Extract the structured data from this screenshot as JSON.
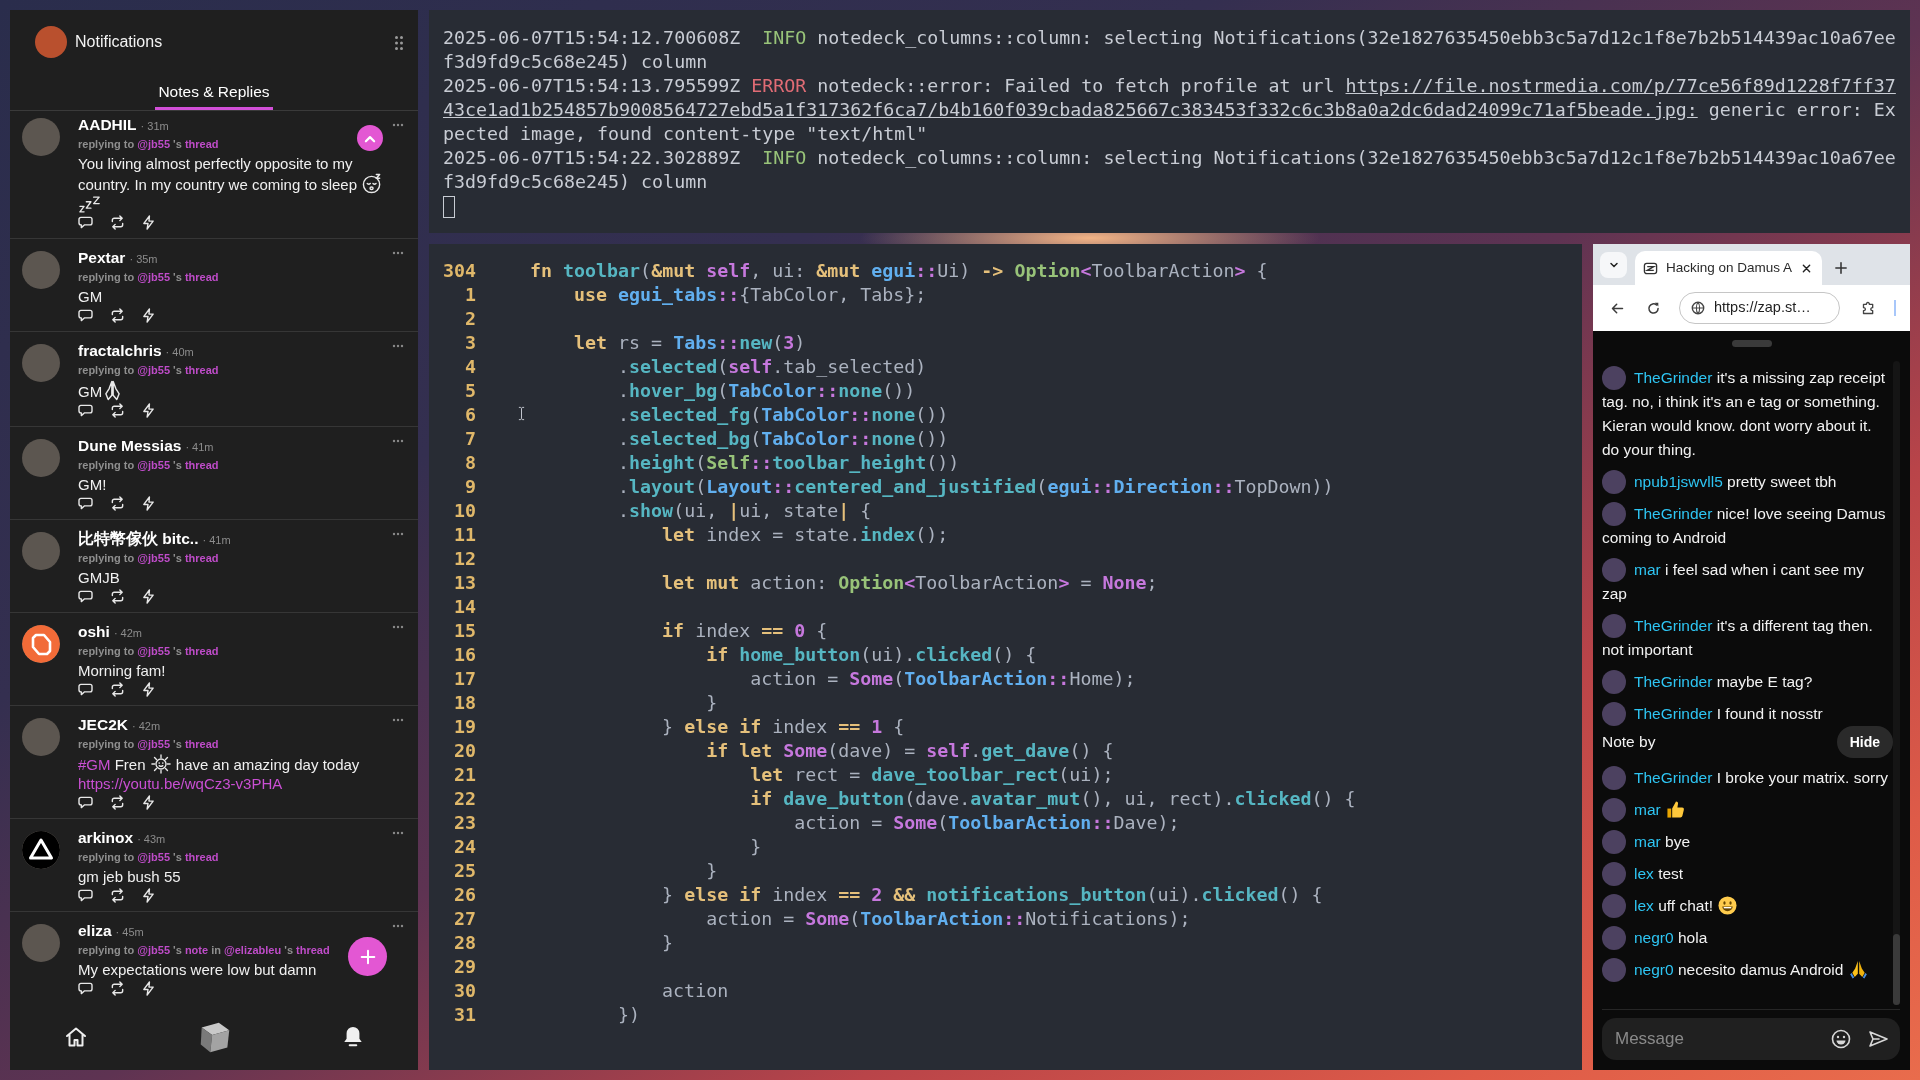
{
  "notifications_panel": {
    "title": "Notifications",
    "tabs": [
      {
        "label": "Notes & Replies",
        "selected": true
      }
    ],
    "notes": [
      {
        "author": "AADHIL",
        "time": "· 31m",
        "avatar": {
          "kind": "photo"
        },
        "reply": [
          {
            "kind": "text",
            "text": "replying to "
          },
          {
            "kind": "link",
            "text": "@jb55"
          },
          {
            "kind": "text",
            "text": " 's "
          },
          {
            "kind": "link",
            "text": "thread"
          }
        ],
        "content": [
          {
            "kind": "text",
            "text": "You living almost perfectly opposite to my country. In my country we coming to sleep "
          },
          {
            "kind": "sleepface"
          },
          {
            "kind": "zzz"
          }
        ]
      },
      {
        "author": "Pextar",
        "time": "· 35m",
        "avatar": {
          "kind": "photo"
        },
        "reply": [
          {
            "kind": "text",
            "text": "replying to "
          },
          {
            "kind": "link",
            "text": "@jb55"
          },
          {
            "kind": "text",
            "text": " 's "
          },
          {
            "kind": "link",
            "text": "thread"
          }
        ],
        "content": [
          {
            "kind": "text",
            "text": "GM"
          }
        ]
      },
      {
        "author": "fractalchris",
        "time": "· 40m",
        "avatar": {
          "kind": "photo"
        },
        "reply": [
          {
            "kind": "text",
            "text": "replying to "
          },
          {
            "kind": "link",
            "text": "@jb55"
          },
          {
            "kind": "text",
            "text": " 's "
          },
          {
            "kind": "link",
            "text": "thread"
          }
        ],
        "content": [
          {
            "kind": "text",
            "text": "GM"
          },
          {
            "kind": "palms"
          }
        ]
      },
      {
        "author": "Dune Messias",
        "time": "· 41m",
        "avatar": {
          "kind": "photo"
        },
        "reply": [
          {
            "kind": "text",
            "text": "replying to "
          },
          {
            "kind": "link",
            "text": "@jb55"
          },
          {
            "kind": "text",
            "text": " 's "
          },
          {
            "kind": "link",
            "text": "thread"
          }
        ],
        "content": [
          {
            "kind": "text",
            "text": "GM!"
          }
        ]
      },
      {
        "author": "比特幣傢伙 bitc..",
        "time": "· 41m",
        "avatar": {
          "kind": "photo"
        },
        "reply": [
          {
            "kind": "text",
            "text": "replying to "
          },
          {
            "kind": "link",
            "text": "@jb55"
          },
          {
            "kind": "text",
            "text": " 's "
          },
          {
            "kind": "link",
            "text": "thread"
          }
        ],
        "content": [
          {
            "kind": "text",
            "text": "GMJB"
          }
        ]
      },
      {
        "author": "oshi",
        "time": "· 42m",
        "avatar": {
          "kind": "octagon"
        },
        "reply": [
          {
            "kind": "text",
            "text": "replying to "
          },
          {
            "kind": "link",
            "text": "@jb55"
          },
          {
            "kind": "text",
            "text": " 's "
          },
          {
            "kind": "link",
            "text": "thread"
          }
        ],
        "content": [
          {
            "kind": "text",
            "text": "Morning fam!"
          }
        ]
      },
      {
        "author": "JEC2K",
        "time": "· 42m",
        "avatar": {
          "kind": "photo"
        },
        "reply": [
          {
            "kind": "text",
            "text": "replying to "
          },
          {
            "kind": "link",
            "text": "@jb55"
          },
          {
            "kind": "text",
            "text": " 's "
          },
          {
            "kind": "link",
            "text": "thread"
          }
        ],
        "content": [
          {
            "kind": "hashtag",
            "text": "#GM"
          },
          {
            "kind": "text",
            "text": " Fren "
          },
          {
            "kind": "sunface"
          },
          {
            "kind": "text",
            "text": " have an amazing day today "
          },
          {
            "kind": "url",
            "text": "https://youtu.be/wqCz3-v3PHA"
          }
        ]
      },
      {
        "author": "arkinox",
        "time": "· 43m",
        "avatar": {
          "kind": "triangle"
        },
        "reply": [
          {
            "kind": "text",
            "text": "replying to "
          },
          {
            "kind": "link",
            "text": "@jb55"
          },
          {
            "kind": "text",
            "text": " 's "
          },
          {
            "kind": "link",
            "text": "thread"
          }
        ],
        "content": [
          {
            "kind": "text",
            "text": "gm jeb bush 55"
          }
        ]
      },
      {
        "author": "eliza",
        "time": "· 45m",
        "avatar": {
          "kind": "photo"
        },
        "reply": [
          {
            "kind": "text",
            "text": "replying to "
          },
          {
            "kind": "link",
            "text": "@jb55"
          },
          {
            "kind": "text",
            "text": " 's "
          },
          {
            "kind": "link",
            "text": "note"
          },
          {
            "kind": "text",
            "text": " in "
          },
          {
            "kind": "link",
            "text": "@elizableu"
          },
          {
            "kind": "text",
            "text": " 's "
          },
          {
            "kind": "link",
            "text": "thread"
          }
        ],
        "content": [
          {
            "kind": "text",
            "text": "My expectations were low but damn"
          }
        ]
      }
    ]
  },
  "terminal": {
    "lines": [
      {
        "time": "2025-06-07T15:54:12.700608Z",
        "severity": "INFO",
        "kind": "info",
        "message": [
          {
            "kind": "text",
            "text": "notedeck_columns::column: selecting Notifications(32e1827635450ebb3c5a7d12c1f8e7b2b514439ac10a67eef3d9fd9c5c68e245) column"
          }
        ]
      },
      {
        "time": "2025-06-07T15:54:13.795599Z",
        "severity": "ERROR",
        "kind": "error",
        "message": [
          {
            "kind": "text",
            "text": "notedeck::error: Failed to fetch profile at url "
          },
          {
            "kind": "link",
            "text": "https://file.nostrmedia.com/p/77ce56f89d1228f7ff3743ce1ad1b254857b9008564727ebd5a1f317362f6ca7/b4b160f039cbada825667c383453f332c6c3b8a0a2dc6dad24099c71af5beade.jpg:"
          },
          {
            "kind": "text",
            "text": " generic error: Expected image, found content-type \"text/html\""
          }
        ]
      },
      {
        "time": "2025-06-07T15:54:22.302889Z",
        "severity": "INFO",
        "kind": "info",
        "message": [
          {
            "kind": "text",
            "text": "notedeck_columns::column: selecting Notifications(32e1827635450ebb3c5a7d12c1f8e7b2b514439ac10a67eef3d9fd9c5c68e245) column"
          }
        ]
      }
    ]
  },
  "editor": {
    "lines": [
      {
        "number": "304",
        "tokens": [
          {
            "kind": "kw",
            "text": "    fn "
          },
          {
            "kind": "fn",
            "text": "toolbar"
          },
          {
            "kind": "tx",
            "text": "("
          },
          {
            "kind": "kw",
            "text": "&mut "
          },
          {
            "kind": "lit",
            "text": "self"
          },
          {
            "kind": "tx",
            "text": ", ui: "
          },
          {
            "kind": "kw",
            "text": "&mut "
          },
          {
            "kind": "ty",
            "text": "egui"
          },
          {
            "kind": "lit",
            "text": "::"
          },
          {
            "kind": "tx",
            "text": "Ui) "
          },
          {
            "kind": "kw",
            "text": "-> "
          },
          {
            "kind": "std",
            "text": "Option"
          },
          {
            "kind": "lit",
            "text": "<"
          },
          {
            "kind": "tx",
            "text": "ToolbarAction"
          },
          {
            "kind": "lit",
            "text": ">"
          },
          {
            "kind": "tx",
            "text": " {"
          }
        ]
      },
      {
        "number": "1",
        "tokens": [
          {
            "kind": "kw",
            "text": "        use "
          },
          {
            "kind": "ty",
            "text": "egui_tabs"
          },
          {
            "kind": "lit",
            "text": "::"
          },
          {
            "kind": "tx",
            "text": "{TabColor, Tabs};"
          }
        ]
      },
      {
        "number": "2"
      },
      {
        "number": "3",
        "tokens": [
          {
            "kind": "kw",
            "text": "        let"
          },
          {
            "kind": "tx",
            "text": " rs = "
          },
          {
            "kind": "ty",
            "text": "Tabs"
          },
          {
            "kind": "lit",
            "text": "::"
          },
          {
            "kind": "fn",
            "text": "new"
          },
          {
            "kind": "tx",
            "text": "("
          },
          {
            "kind": "lit",
            "text": "3"
          },
          {
            "kind": "tx",
            "text": ")"
          }
        ]
      },
      {
        "number": "4",
        "tokens": [
          {
            "kind": "tx",
            "text": "            ."
          },
          {
            "kind": "fn",
            "text": "selected"
          },
          {
            "kind": "tx",
            "text": "("
          },
          {
            "kind": "lit",
            "text": "self"
          },
          {
            "kind": "tx",
            "text": ".tab_selected)"
          }
        ]
      },
      {
        "number": "5",
        "tokens": [
          {
            "kind": "tx",
            "text": "            ."
          },
          {
            "kind": "fn",
            "text": "hover_bg"
          },
          {
            "kind": "tx",
            "text": "("
          },
          {
            "kind": "ty",
            "text": "TabColor"
          },
          {
            "kind": "lit",
            "text": "::"
          },
          {
            "kind": "fn",
            "text": "none"
          },
          {
            "kind": "tx",
            "text": "())"
          }
        ]
      },
      {
        "number": "6",
        "tokens": [
          {
            "kind": "tx",
            "text": "            ."
          },
          {
            "kind": "fn",
            "text": "selected_fg"
          },
          {
            "kind": "tx",
            "text": "("
          },
          {
            "kind": "ty",
            "text": "TabColor"
          },
          {
            "kind": "lit",
            "text": "::"
          },
          {
            "kind": "fn",
            "text": "none"
          },
          {
            "kind": "tx",
            "text": "())"
          }
        ]
      },
      {
        "number": "7",
        "tokens": [
          {
            "kind": "tx",
            "text": "            ."
          },
          {
            "kind": "fn",
            "text": "selected_bg"
          },
          {
            "kind": "tx",
            "text": "("
          },
          {
            "kind": "ty",
            "text": "TabColor"
          },
          {
            "kind": "lit",
            "text": "::"
          },
          {
            "kind": "fn",
            "text": "none"
          },
          {
            "kind": "tx",
            "text": "())"
          }
        ]
      },
      {
        "number": "8",
        "tokens": [
          {
            "kind": "tx",
            "text": "            ."
          },
          {
            "kind": "fn",
            "text": "height"
          },
          {
            "kind": "tx",
            "text": "("
          },
          {
            "kind": "std",
            "text": "Self"
          },
          {
            "kind": "lit",
            "text": "::"
          },
          {
            "kind": "fn",
            "text": "toolbar_height"
          },
          {
            "kind": "tx",
            "text": "())"
          }
        ]
      },
      {
        "number": "9",
        "tokens": [
          {
            "kind": "tx",
            "text": "            ."
          },
          {
            "kind": "fn",
            "text": "layout"
          },
          {
            "kind": "tx",
            "text": "("
          },
          {
            "kind": "ty",
            "text": "Layout"
          },
          {
            "kind": "lit",
            "text": "::"
          },
          {
            "kind": "fn",
            "text": "centered_and_justified"
          },
          {
            "kind": "tx",
            "text": "("
          },
          {
            "kind": "ty",
            "text": "egui"
          },
          {
            "kind": "lit",
            "text": "::"
          },
          {
            "kind": "ty",
            "text": "Direction"
          },
          {
            "kind": "lit",
            "text": "::"
          },
          {
            "kind": "tx",
            "text": "TopDown))"
          }
        ]
      },
      {
        "number": "10",
        "tokens": [
          {
            "kind": "tx",
            "text": "            ."
          },
          {
            "kind": "fn",
            "text": "show"
          },
          {
            "kind": "tx",
            "text": "(ui, "
          },
          {
            "kind": "kw",
            "text": "|"
          },
          {
            "kind": "tx",
            "text": "ui, state"
          },
          {
            "kind": "kw",
            "text": "|"
          },
          {
            "kind": "tx",
            "text": " {"
          }
        ]
      },
      {
        "number": "11",
        "tokens": [
          {
            "kind": "kw",
            "text": "                let"
          },
          {
            "kind": "tx",
            "text": " index = state."
          },
          {
            "kind": "fn",
            "text": "index"
          },
          {
            "kind": "tx",
            "text": "();"
          }
        ]
      },
      {
        "number": "12"
      },
      {
        "number": "13",
        "tokens": [
          {
            "kind": "kw",
            "text": "                let mut"
          },
          {
            "kind": "tx",
            "text": " action: "
          },
          {
            "kind": "std",
            "text": "Option"
          },
          {
            "kind": "lit",
            "text": "<"
          },
          {
            "kind": "tx",
            "text": "ToolbarAction"
          },
          {
            "kind": "lit",
            "text": ">"
          },
          {
            "kind": "tx",
            "text": " = "
          },
          {
            "kind": "lit",
            "text": "None"
          },
          {
            "kind": "tx",
            "text": ";"
          }
        ]
      },
      {
        "number": "14"
      },
      {
        "number": "15",
        "tokens": [
          {
            "kind": "kw",
            "text": "                if"
          },
          {
            "kind": "tx",
            "text": " index "
          },
          {
            "kind": "kw",
            "text": "== "
          },
          {
            "kind": "lit",
            "text": "0"
          },
          {
            "kind": "tx",
            "text": " {"
          }
        ]
      },
      {
        "number": "16",
        "tokens": [
          {
            "kind": "kw",
            "text": "                    if "
          },
          {
            "kind": "fn",
            "text": "home_button"
          },
          {
            "kind": "tx",
            "text": "(ui)."
          },
          {
            "kind": "fn",
            "text": "clicked"
          },
          {
            "kind": "tx",
            "text": "() {"
          }
        ]
      },
      {
        "number": "17",
        "tokens": [
          {
            "kind": "tx",
            "text": "                        action = "
          },
          {
            "kind": "lit",
            "text": "Some"
          },
          {
            "kind": "tx",
            "text": "("
          },
          {
            "kind": "ty",
            "text": "ToolbarAction"
          },
          {
            "kind": "lit",
            "text": "::"
          },
          {
            "kind": "tx",
            "text": "Home);"
          }
        ]
      },
      {
        "number": "18",
        "tokens": [
          {
            "kind": "tx",
            "text": "                    }"
          }
        ]
      },
      {
        "number": "19",
        "tokens": [
          {
            "kind": "tx",
            "text": "                } "
          },
          {
            "kind": "kw",
            "text": "else if"
          },
          {
            "kind": "tx",
            "text": " index "
          },
          {
            "kind": "kw",
            "text": "== "
          },
          {
            "kind": "lit",
            "text": "1"
          },
          {
            "kind": "tx",
            "text": " {"
          }
        ]
      },
      {
        "number": "20",
        "tokens": [
          {
            "kind": "kw",
            "text": "                    if let "
          },
          {
            "kind": "lit",
            "text": "Some"
          },
          {
            "kind": "tx",
            "text": "(dave) = "
          },
          {
            "kind": "lit",
            "text": "self"
          },
          {
            "kind": "tx",
            "text": "."
          },
          {
            "kind": "fn",
            "text": "get_dave"
          },
          {
            "kind": "tx",
            "text": "() {"
          }
        ]
      },
      {
        "number": "21",
        "tokens": [
          {
            "kind": "kw",
            "text": "                        let"
          },
          {
            "kind": "tx",
            "text": " rect = "
          },
          {
            "kind": "fn",
            "text": "dave_toolbar_rect"
          },
          {
            "kind": "tx",
            "text": "(ui);"
          }
        ]
      },
      {
        "number": "22",
        "tokens": [
          {
            "kind": "kw",
            "text": "                        if "
          },
          {
            "kind": "fn",
            "text": "dave_button"
          },
          {
            "kind": "tx",
            "text": "(dave."
          },
          {
            "kind": "fn",
            "text": "avatar_mut"
          },
          {
            "kind": "tx",
            "text": "(), ui, rect)."
          },
          {
            "kind": "fn",
            "text": "clicked"
          },
          {
            "kind": "tx",
            "text": "() {"
          }
        ]
      },
      {
        "number": "23",
        "tokens": [
          {
            "kind": "tx",
            "text": "                            action = "
          },
          {
            "kind": "lit",
            "text": "Some"
          },
          {
            "kind": "tx",
            "text": "("
          },
          {
            "kind": "ty",
            "text": "ToolbarAction"
          },
          {
            "kind": "lit",
            "text": "::"
          },
          {
            "kind": "tx",
            "text": "Dave);"
          }
        ]
      },
      {
        "number": "24",
        "tokens": [
          {
            "kind": "tx",
            "text": "                        }"
          }
        ]
      },
      {
        "number": "25",
        "tokens": [
          {
            "kind": "tx",
            "text": "                    }"
          }
        ]
      },
      {
        "number": "26",
        "tokens": [
          {
            "kind": "tx",
            "text": "                } "
          },
          {
            "kind": "kw",
            "text": "else if"
          },
          {
            "kind": "tx",
            "text": " index "
          },
          {
            "kind": "kw",
            "text": "== "
          },
          {
            "kind": "lit",
            "text": "2 "
          },
          {
            "kind": "kw",
            "text": "&& "
          },
          {
            "kind": "fn",
            "text": "notifications_button"
          },
          {
            "kind": "tx",
            "text": "(ui)."
          },
          {
            "kind": "fn",
            "text": "clicked"
          },
          {
            "kind": "tx",
            "text": "() {"
          }
        ]
      },
      {
        "number": "27",
        "tokens": [
          {
            "kind": "tx",
            "text": "                    action = "
          },
          {
            "kind": "lit",
            "text": "Some"
          },
          {
            "kind": "tx",
            "text": "("
          },
          {
            "kind": "ty",
            "text": "ToolbarAction"
          },
          {
            "kind": "lit",
            "text": "::"
          },
          {
            "kind": "tx",
            "text": "Notifications);"
          }
        ]
      },
      {
        "number": "28",
        "tokens": [
          {
            "kind": "tx",
            "text": "                }"
          }
        ]
      },
      {
        "number": "29"
      },
      {
        "number": "30",
        "tokens": [
          {
            "kind": "tx",
            "text": "                action"
          }
        ]
      },
      {
        "number": "31",
        "tokens": [
          {
            "kind": "tx",
            "text": "            })"
          }
        ]
      }
    ]
  },
  "browser": {
    "tab": {
      "title": "Hacking on Damus A"
    },
    "address": "https://zap.st…",
    "messages": [
      {
        "author": "TheGrinder",
        "parts": [
          {
            "kind": "text",
            "text": "it's a missing zap receipt tag. no, i think it's an e tag or something. Kieran would know. dont worry about it. do your thing."
          }
        ]
      },
      {
        "author": "npub1jswvll5",
        "parts": [
          {
            "kind": "text",
            "text": "pretty sweet tbh"
          }
        ]
      },
      {
        "author": "TheGrinder",
        "parts": [
          {
            "kind": "text",
            "text": "nice! love seeing Damus coming to Android"
          }
        ]
      },
      {
        "author": "mar",
        "parts": [
          {
            "kind": "text",
            "text": "i feel sad when i cant see my zap"
          }
        ]
      },
      {
        "author": "TheGrinder",
        "parts": [
          {
            "kind": "text",
            "text": "it's a different tag then. not important"
          }
        ]
      },
      {
        "author": "TheGrinder",
        "parts": [
          {
            "kind": "text",
            "text": "maybe E tag?"
          }
        ]
      },
      {
        "author": "TheGrinder",
        "parts": [
          {
            "kind": "text",
            "text": "I found it nosstr"
          }
        ],
        "embed": {
          "label": "Note by",
          "button": "Hide"
        }
      },
      {
        "author": "TheGrinder",
        "parts": [
          {
            "kind": "text",
            "text": "I broke your matrix. sorry"
          }
        ]
      },
      {
        "author": "mar",
        "parts": [
          {
            "kind": "thumbsup"
          }
        ]
      },
      {
        "author": "mar",
        "parts": [
          {
            "kind": "text",
            "text": "bye"
          }
        ]
      },
      {
        "author": "lex",
        "parts": [
          {
            "kind": "text",
            "text": "test"
          }
        ]
      },
      {
        "author": "lex",
        "parts": [
          {
            "kind": "text",
            "text": "uff chat!"
          },
          {
            "kind": "grin"
          }
        ]
      },
      {
        "author": "negr0",
        "parts": [
          {
            "kind": "text",
            "text": "hola"
          }
        ]
      },
      {
        "author": "negr0",
        "parts": [
          {
            "kind": "text",
            "text": "necesito damus Android"
          },
          {
            "kind": "prayer"
          }
        ]
      }
    ],
    "composer": {
      "placeholder": "Message"
    }
  }
}
